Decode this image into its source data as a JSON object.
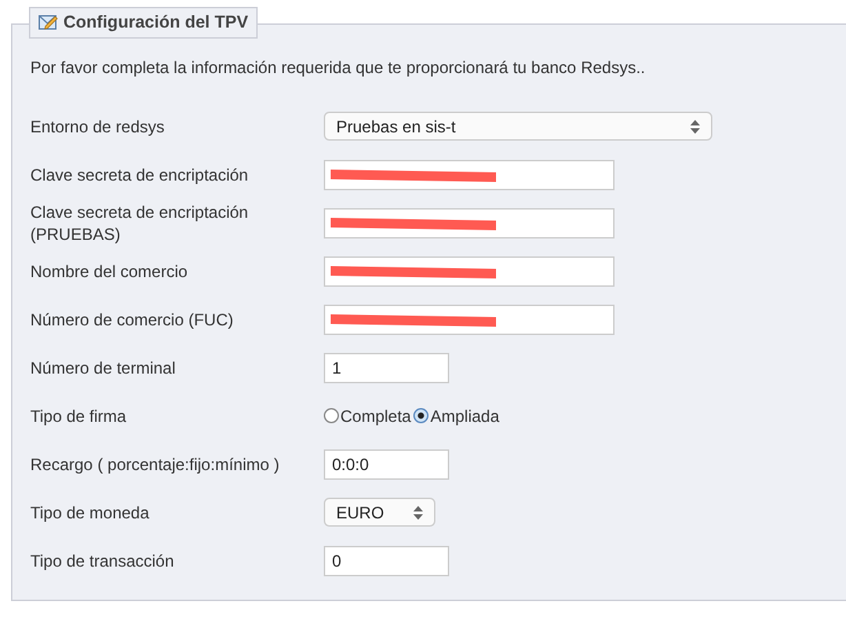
{
  "panel": {
    "title": "Configuración del TPV",
    "intro": "Por favor completa la información requerida que te proporcionará tu banco Redsys.."
  },
  "rows": [
    {
      "label": "Entorno de redsys",
      "kind": "select",
      "value": "Pruebas en sis-t"
    },
    {
      "label": "Clave secreta de encriptación",
      "kind": "redacted"
    },
    {
      "label": "Clave secreta de encriptación (PRUEBAS)",
      "kind": "redacted"
    },
    {
      "label": "Nombre del comercio",
      "kind": "redacted"
    },
    {
      "label": "Número de comercio (FUC)",
      "kind": "redacted"
    },
    {
      "label": "Número de terminal",
      "kind": "text",
      "value": "1"
    },
    {
      "label": "Tipo de firma",
      "kind": "radio",
      "options": [
        {
          "label": "Completa",
          "selected": false
        },
        {
          "label": "Ampliada",
          "selected": true
        }
      ]
    },
    {
      "label": "Recargo ( porcentaje:fijo:mínimo )",
      "kind": "text",
      "value": "0:0:0"
    },
    {
      "label": "Tipo de moneda",
      "kind": "select",
      "value": "EURO"
    },
    {
      "label": "Tipo de transacción",
      "kind": "text",
      "value": "0"
    }
  ]
}
